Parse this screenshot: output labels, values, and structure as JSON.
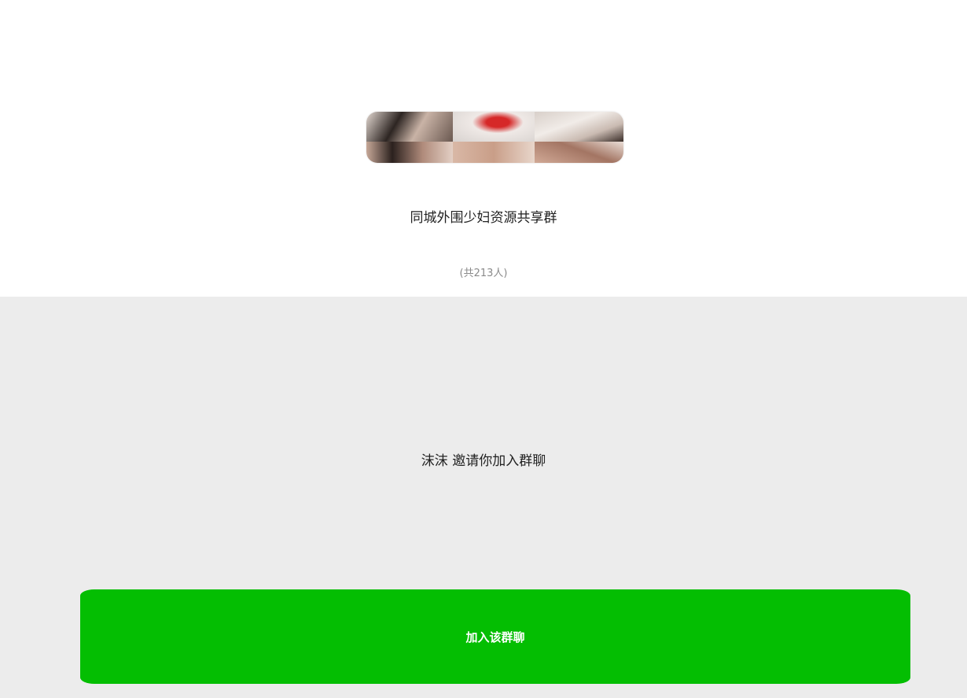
{
  "group": {
    "name": "同城外围少妇资源共享群",
    "member_count": "(共213人)"
  },
  "invite": {
    "text": "沫沫 邀请你加入群聊"
  },
  "join_button": {
    "label": "加入该群聊",
    "color": "#04be02"
  },
  "colors": {
    "top_background": "#ffffff",
    "bottom_background": "#ececec"
  }
}
